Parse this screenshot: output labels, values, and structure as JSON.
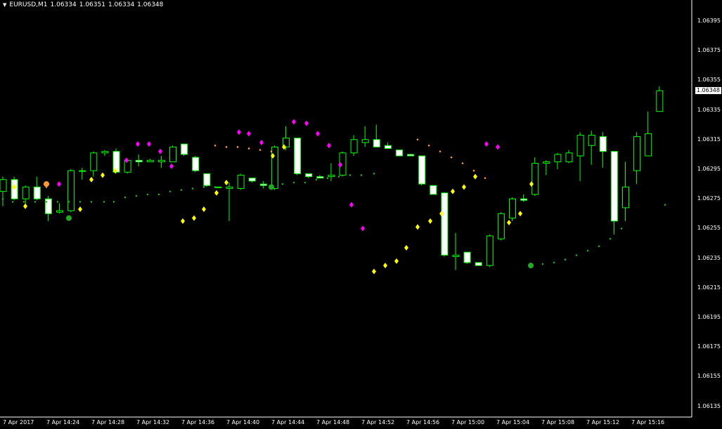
{
  "header": {
    "menu_icon": "triangle-down-icon",
    "symbol": "EURUSD,M1",
    "open": "1.06334",
    "high": "1.06351",
    "low": "1.06334",
    "close": "1.06348"
  },
  "current_price": "1.06348",
  "colors": {
    "background": "#000000",
    "axis": "#ffffff",
    "candle_up_body": "#000000",
    "candle_down_body": "#ffffff",
    "candle_outline": "#00ff00",
    "sar_low": "#ffff00",
    "sar_high": "#ff00ff",
    "line_green": "#22aa22",
    "line_orange": "#ff9933"
  },
  "chart_data": {
    "type": "candlestick",
    "timeframe": "M1",
    "ylim": [
      1.0613,
      1.0641
    ],
    "y_ticks": [
      "1.06395",
      "1.06375",
      "1.06355",
      "1.06335",
      "1.06315",
      "1.06295",
      "1.06275",
      "1.06255",
      "1.06235",
      "1.06215",
      "1.06195",
      "1.06175",
      "1.06155",
      "1.06135"
    ],
    "x_ticks": [
      "7 Apr 2017",
      "7 Apr 14:24",
      "7 Apr 14:28",
      "7 Apr 14:32",
      "7 Apr 14:36",
      "7 Apr 14:40",
      "7 Apr 14:44",
      "7 Apr 14:48",
      "7 Apr 14:52",
      "7 Apr 14:56",
      "7 Apr 15:00",
      "7 Apr 15:04",
      "7 Apr 15:08",
      "7 Apr 15:12",
      "7 Apr 15:16"
    ],
    "candles": [
      [
        1.0628,
        1.0629,
        1.0627,
        1.06288
      ],
      [
        1.06288,
        1.0629,
        1.06274,
        1.06275
      ],
      [
        1.06275,
        1.06284,
        1.0627,
        1.06283
      ],
      [
        1.06283,
        1.0629,
        1.06274,
        1.06275
      ],
      [
        1.06275,
        1.06277,
        1.0626,
        1.06265
      ],
      [
        1.06266,
        1.06272,
        1.06265,
        1.06267
      ],
      [
        1.06267,
        1.06295,
        1.06266,
        1.06294
      ],
      [
        1.06294,
        1.06296,
        1.06288,
        1.06294
      ],
      [
        1.06294,
        1.06307,
        1.0629,
        1.06306
      ],
      [
        1.06306,
        1.06308,
        1.06304,
        1.06307
      ],
      [
        1.06307,
        1.06309,
        1.06292,
        1.06293
      ],
      [
        1.06293,
        1.06302,
        1.06292,
        1.06301
      ],
      [
        1.06301,
        1.06305,
        1.06297,
        1.063
      ],
      [
        1.063,
        1.06302,
        1.063,
        1.06301
      ],
      [
        1.063,
        1.06304,
        1.06296,
        1.06301
      ],
      [
        1.063,
        1.06311,
        1.063,
        1.0631
      ],
      [
        1.06312,
        1.06312,
        1.06304,
        1.06305
      ],
      [
        1.06303,
        1.06304,
        1.06293,
        1.06294
      ],
      [
        1.06292,
        1.06292,
        1.06283,
        1.06284
      ],
      [
        1.06283,
        1.06283,
        1.06283,
        1.06283
      ],
      [
        1.06282,
        1.06286,
        1.0626,
        1.06283
      ],
      [
        1.06282,
        1.06292,
        1.06281,
        1.06291
      ],
      [
        1.06289,
        1.06289,
        1.06286,
        1.06287
      ],
      [
        1.06285,
        1.06287,
        1.06282,
        1.06284
      ],
      [
        1.06282,
        1.06311,
        1.06281,
        1.0631
      ],
      [
        1.0631,
        1.06324,
        1.06308,
        1.06316
      ],
      [
        1.06316,
        1.06316,
        1.06291,
        1.06292
      ],
      [
        1.06292,
        1.06292,
        1.06289,
        1.0629
      ],
      [
        1.0629,
        1.06291,
        1.06289,
        1.06289
      ],
      [
        1.0629,
        1.06299,
        1.06287,
        1.06291
      ],
      [
        1.06291,
        1.06307,
        1.0629,
        1.06306
      ],
      [
        1.06306,
        1.06318,
        1.06304,
        1.06315
      ],
      [
        1.06313,
        1.06324,
        1.0631,
        1.06315
      ],
      [
        1.06315,
        1.06325,
        1.0631,
        1.0631
      ],
      [
        1.06311,
        1.06313,
        1.06309,
        1.06309
      ],
      [
        1.06308,
        1.06308,
        1.06304,
        1.06304
      ],
      [
        1.06305,
        1.06305,
        1.06304,
        1.06304
      ],
      [
        1.06304,
        1.06304,
        1.06284,
        1.06285
      ],
      [
        1.06284,
        1.06284,
        1.06278,
        1.06278
      ],
      [
        1.06279,
        1.06279,
        1.06236,
        1.06237
      ],
      [
        1.06236,
        1.06252,
        1.06227,
        1.06237
      ],
      [
        1.06239,
        1.06239,
        1.06231,
        1.06232
      ],
      [
        1.06232,
        1.06232,
        1.0623,
        1.0623
      ],
      [
        1.0623,
        1.06251,
        1.06229,
        1.0625
      ],
      [
        1.06248,
        1.06266,
        1.06247,
        1.06265
      ],
      [
        1.06262,
        1.06276,
        1.0626,
        1.06275
      ],
      [
        1.06275,
        1.06278,
        1.06273,
        1.06274
      ],
      [
        1.06278,
        1.06303,
        1.06277,
        1.06299
      ],
      [
        1.06299,
        1.06301,
        1.06291,
        1.063
      ],
      [
        1.063,
        1.06306,
        1.06295,
        1.06305
      ],
      [
        1.063,
        1.06308,
        1.06299,
        1.06306
      ],
      [
        1.06304,
        1.0632,
        1.06287,
        1.06318
      ],
      [
        1.06311,
        1.06321,
        1.06298,
        1.06318
      ],
      [
        1.06317,
        1.0632,
        1.06296,
        1.06307
      ],
      [
        1.06307,
        1.06307,
        1.06251,
        1.0626
      ],
      [
        1.06269,
        1.063,
        1.0626,
        1.06283
      ],
      [
        1.06294,
        1.0632,
        1.06285,
        1.06317
      ],
      [
        1.06304,
        1.06334,
        1.06304,
        1.06319
      ],
      [
        1.06334,
        1.06351,
        1.06334,
        1.06348
      ]
    ],
    "sar_points": [
      [
        1.06283,
        "yellow"
      ],
      [
        1.0627,
        "yellow"
      ],
      [
        1.06285,
        "orange"
      ],
      [
        1.06285,
        "magenta"
      ],
      [
        1.06262,
        "yellow"
      ],
      [
        1.06268,
        "yellow"
      ],
      [
        1.06288,
        "yellow"
      ],
      [
        1.06291,
        "yellow"
      ],
      [
        1.06294,
        "yellow"
      ],
      [
        1.06301,
        "magenta"
      ],
      [
        1.06312,
        "magenta"
      ],
      [
        1.06312,
        "magenta"
      ],
      [
        1.06307,
        "magenta"
      ],
      [
        1.06297,
        "magenta"
      ],
      [
        1.0626,
        "yellow"
      ],
      [
        1.06262,
        "yellow"
      ],
      [
        1.06268,
        "yellow"
      ],
      [
        1.06279,
        "yellow"
      ],
      [
        1.06286,
        "yellow"
      ],
      [
        1.0632,
        "magenta"
      ],
      [
        1.06319,
        "magenta"
      ],
      [
        1.06313,
        "magenta"
      ],
      [
        1.06304,
        "yellow"
      ],
      [
        1.0631,
        "yellow"
      ],
      [
        1.06327,
        "magenta"
      ],
      [
        1.06326,
        "magenta"
      ],
      [
        1.06319,
        "magenta"
      ],
      [
        1.06311,
        "magenta"
      ],
      [
        1.06298,
        "magenta"
      ],
      [
        1.06271,
        "magenta"
      ],
      [
        1.06255,
        "magenta"
      ],
      [
        1.06226,
        "yellow"
      ],
      [
        1.0623,
        "yellow"
      ],
      [
        1.06233,
        "yellow"
      ],
      [
        1.06242,
        "yellow"
      ],
      [
        1.06256,
        "yellow"
      ],
      [
        1.0626,
        "yellow"
      ],
      [
        1.06265,
        "yellow"
      ],
      [
        1.0628,
        "yellow"
      ],
      [
        1.06283,
        "yellow"
      ],
      [
        1.0629,
        "yellow"
      ],
      [
        1.06312,
        "magenta"
      ],
      [
        1.0631,
        "magenta"
      ],
      [
        1.06259,
        "yellow"
      ],
      [
        1.06265,
        "yellow"
      ],
      [
        1.06285,
        "yellow"
      ]
    ],
    "green_line": [
      [
        1.06275,
        1.06273,
        1.06273,
        1.06273,
        1.06273,
        1.06273,
        1.06273,
        1.06273,
        1.06273,
        1.06273
      ],
      [
        1.06273,
        1.06276,
        1.06277,
        1.06278,
        1.06278,
        1.0628,
        1.06281,
        1.06282,
        1.06283,
        1.06283
      ],
      [
        1.06283,
        1.06285,
        1.06286,
        1.06286,
        1.06288,
        1.06289,
        1.0629,
        1.06291,
        1.06291,
        1.06292
      ],
      [
        1.0623,
        1.06231,
        1.06232,
        1.06234,
        1.06237,
        1.0624,
        1.06243,
        1.06248,
        1.06255,
        1.06271
      ]
    ],
    "orange_line": [
      [
        1.06283,
        1.06283
      ],
      [
        1.06311,
        1.0631,
        1.0631,
        1.06309,
        1.06308,
        1.06307
      ],
      [
        1.06315,
        1.06311,
        1.06307,
        1.06303,
        1.06299,
        1.06294,
        1.06289
      ]
    ]
  }
}
